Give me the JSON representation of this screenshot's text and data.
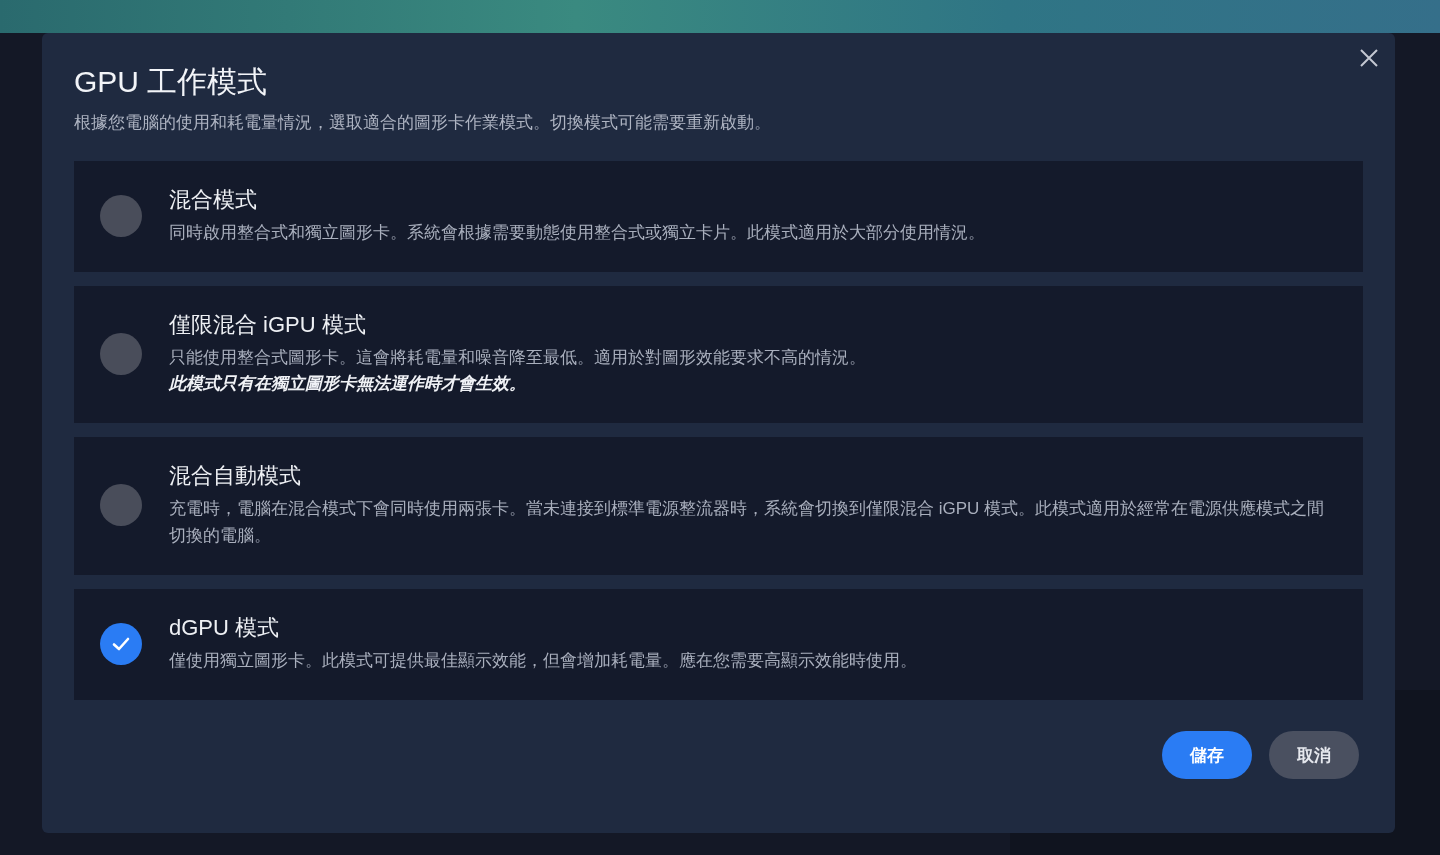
{
  "dialog": {
    "title": "GPU 工作模式",
    "subtitle": "根據您電腦的使用和耗電量情況，選取適合的圖形卡作業模式。切換模式可能需要重新啟動。",
    "options": [
      {
        "title": "混合模式",
        "description": "同時啟用整合式和獨立圖形卡。系統會根據需要動態使用整合式或獨立卡片。此模式適用於大部分使用情況。",
        "selected": false
      },
      {
        "title": "僅限混合 iGPU 模式",
        "description": "只能使用整合式圖形卡。這會將耗電量和噪音降至最低。適用於對圖形效能要求不高的情況。",
        "note": "此模式只有在獨立圖形卡無法運作時才會生效。",
        "selected": false
      },
      {
        "title": "混合自動模式",
        "description": "充電時，電腦在混合模式下會同時使用兩張卡。當未連接到標準電源整流器時，系統會切換到僅限混合 iGPU 模式。此模式適用於經常在電源供應模式之間切換的電腦。",
        "selected": false
      },
      {
        "title": "dGPU 模式",
        "description": "僅使用獨立圖形卡。此模式可提供最佳顯示效能，但會增加耗電量。應在您需要高顯示效能時使用。",
        "selected": true
      }
    ],
    "buttons": [
      {
        "label": "儲存",
        "kind": "primary"
      },
      {
        "label": "取消",
        "kind": "secondary"
      }
    ]
  }
}
